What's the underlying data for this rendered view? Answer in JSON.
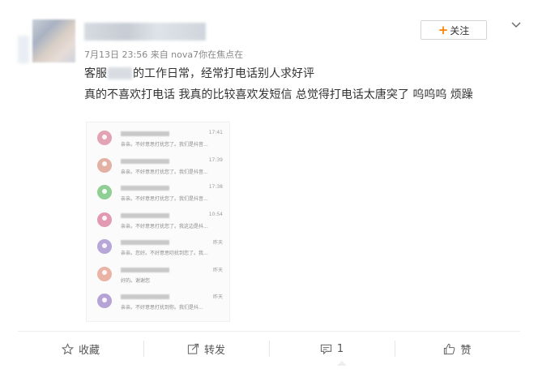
{
  "post": {
    "meta": "7月13日 23:56 来自 nova7你在焦点在",
    "follow_label": "关注",
    "text_line1_prefix": "客服",
    "text_line1_suffix": "的工作日常，经常打电话别人求好评",
    "text_line2": "真的不喜欢打电话   我真的比较喜欢发短信  总觉得打电话太唐突了  呜呜呜  烦躁"
  },
  "image_messages": [
    {
      "time": "17:41",
      "text": "亲亲。不好意思打扰您了。我们是抖音...",
      "avatar_color": "#e2a3b5"
    },
    {
      "time": "17:39",
      "text": "亲亲。不好意思打扰您了。我们是抖音...",
      "avatar_color": "#e3b0a4"
    },
    {
      "time": "17:38",
      "text": "亲亲。不好意思打扰您了。我们是抖音...",
      "avatar_color": "#8fcf95"
    },
    {
      "time": "10:54",
      "text": "亲亲。不好意思打扰您了。我这边是抖...",
      "avatar_color": "#e29ab2"
    },
    {
      "time": "昨天",
      "text": "亲亲。您好。不好意思叨扰到您了。我...",
      "avatar_color": "#b7a6d8"
    },
    {
      "time": "昨天",
      "text": "好的。谢谢您",
      "avatar_color": "#e9b4a5"
    },
    {
      "time": "昨天",
      "text": "亲亲。不好意思打扰到你。我们是抖...",
      "avatar_color": "#b5a3d6"
    }
  ],
  "actions": {
    "favorite": "收藏",
    "repost": "转发",
    "comment": "1",
    "like": "赞"
  },
  "colors": {
    "accent": "#ff8200"
  }
}
